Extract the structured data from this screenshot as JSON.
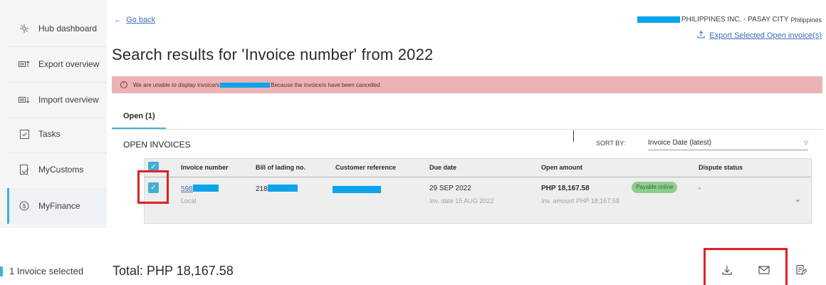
{
  "sidebar": {
    "items": [
      {
        "label": "Hub dashboard",
        "icon": "hub-icon"
      },
      {
        "label": "Export overview",
        "icon": "export-icon"
      },
      {
        "label": "Import overview",
        "icon": "import-icon"
      },
      {
        "label": "Tasks",
        "icon": "tasks-icon"
      },
      {
        "label": "MyCustoms",
        "icon": "customs-icon"
      },
      {
        "label": "MyFinance",
        "icon": "finance-icon"
      }
    ]
  },
  "header": {
    "go_back": "Go back",
    "company": "PHILIPPINES INC. - PASAY CITY",
    "company_country": "Philippines",
    "export_link": "Export Selected Open invoice(s)",
    "title": "Search results for 'Invoice number' from 2022"
  },
  "alert": {
    "text_before": "We are unable to display invoice/s",
    "text_after": "Because the invoice/s have been cancelled"
  },
  "tabs": [
    {
      "label": "Open (1)"
    }
  ],
  "list": {
    "heading": "OPEN INVOICES",
    "sort_label": "SORT BY:",
    "sort_value": "Invoice Date (latest)"
  },
  "table": {
    "columns": [
      "Invoice number",
      "Bill of lading no.",
      "Customer reference",
      "Due date",
      "Open amount",
      "Dispute status"
    ],
    "rows": [
      {
        "invoice_prefix": "598",
        "invoice_sub": "Local",
        "bol_prefix": "218",
        "due_date": "29 SEP 2022",
        "inv_date": "Inv. date 15 AUG 2022",
        "open_amount": "PHP 18,167.58",
        "inv_amount": "Inv. amount PHP 18,167.58",
        "badge": "Payable online",
        "dispute": "-"
      }
    ]
  },
  "footer": {
    "selected": "1 Invoice selected",
    "total": "Total: PHP 18,167.58"
  },
  "colors": {
    "accent": "#42b0d5",
    "alert_bg": "#ebb3b5",
    "redaction": "#0aa4ea",
    "highlight_box": "#e02020",
    "badge_bg": "#8fcc8f"
  }
}
